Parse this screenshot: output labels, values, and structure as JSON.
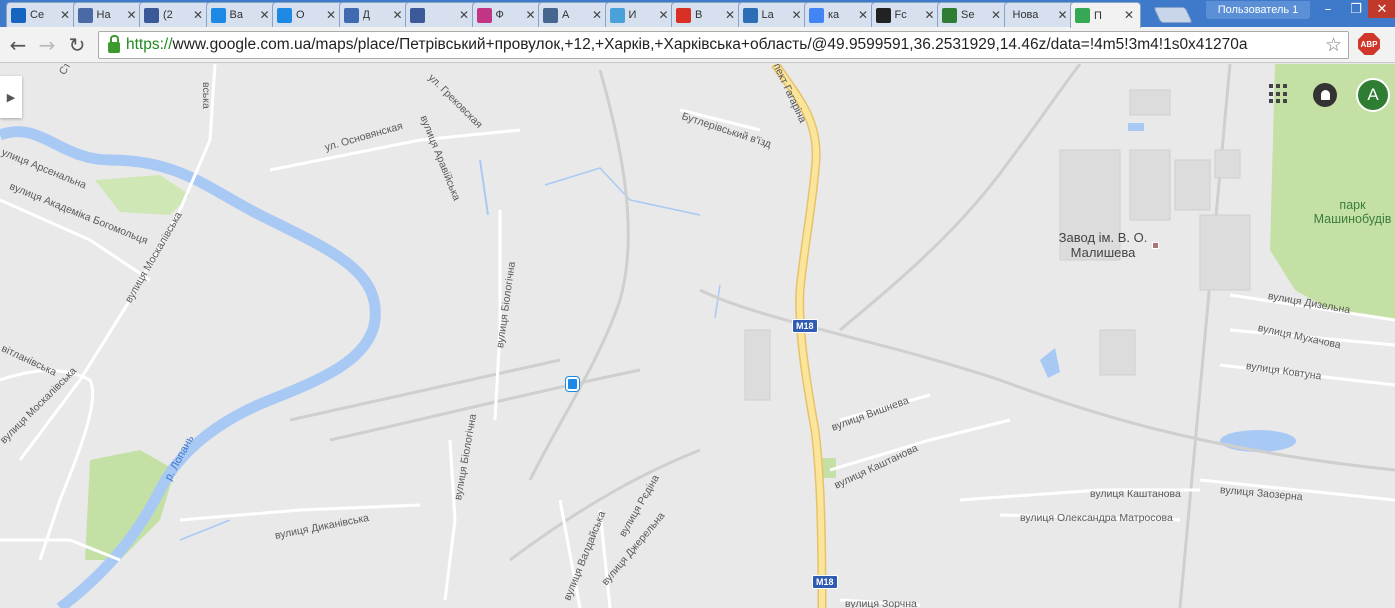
{
  "browser": {
    "tabs": [
      {
        "title": "Ce",
        "icon": "arrow-up-icon",
        "color": "#1565c0"
      },
      {
        "title": "Ha",
        "icon": "bl-icon",
        "color": "#4a6aa5"
      },
      {
        "title": "(2",
        "icon": "facebook-icon",
        "color": "#3b5998"
      },
      {
        "title": "Ba",
        "icon": "ring-icon",
        "color": "#1e88e5"
      },
      {
        "title": "O",
        "icon": "ring-icon",
        "color": "#1e88e5"
      },
      {
        "title": "Д",
        "icon": "chat-icon",
        "color": "#3f6ab0"
      },
      {
        "title": "",
        "icon": "play-icon",
        "color": "#3c5a99"
      },
      {
        "title": "Ф",
        "icon": "instagram-icon",
        "color": "#c13584"
      },
      {
        "title": "A",
        "icon": "vk-icon",
        "color": "#45668e"
      },
      {
        "title": "И",
        "icon": "swirl-icon",
        "color": "#4aa0d8"
      },
      {
        "title": "B",
        "icon": "gmail-icon",
        "color": "#d93025"
      },
      {
        "title": "La",
        "icon": "w-icon",
        "color": "#2d6db5"
      },
      {
        "title": "ка",
        "icon": "google-icon",
        "color": "#4285f4"
      },
      {
        "title": "Fc",
        "icon": "film-icon",
        "color": "#222222"
      },
      {
        "title": "Se",
        "icon": "check-icon",
        "color": "#2e7d32"
      },
      {
        "title": "Нова",
        "icon": "",
        "color": ""
      },
      {
        "title": "П",
        "icon": "maps-icon",
        "color": "#34a853"
      }
    ],
    "close_symbol": "✕",
    "user": "Пользователь 1",
    "url_https": "https://",
    "url_rest": "www.google.com.ua/maps/place/Петрівський+провулок,+12,+Харків,+Харківська+область/@49.9599591,36.2531929,14.46z/data=!4m5!3m4!1s0x41270a",
    "abp": "ABP",
    "back": "←",
    "forward": "→",
    "reload": "↻",
    "star": "☆",
    "minimize": "–",
    "maximize": "❐",
    "window_close": "✕"
  },
  "map": {
    "avatar_letter": "A",
    "streets": [
      "Сте",
      "вська",
      "ул. Грековская",
      "вулиця Аравійська",
      "ул. Основянская",
      "улиця Арсенальна",
      "вулиця Академіка Богомольця",
      "вулиця Москалівська",
      "вітланівська",
      "вулиця Москалівська",
      "вулиця Біологічна",
      "вулиця Біологічна",
      "вулиця Диканівська",
      "вулиця Валдайська",
      "вулиця Рєдіна",
      "вулиця Джерельна",
      "Бутлерівський в'їзд",
      "пект Гагаріна",
      "вулиця Вишнева",
      "вулиця Каштанова",
      "вулиця Каштанова",
      "вулиця Олександра Матросова",
      "вулиця Дизельна",
      "вулиця Мухачова",
      "вулиця Ковтуна",
      "вулиця Заозерна",
      "вулиця Зорчна"
    ],
    "river": "р. Лопань",
    "highway": "M18",
    "landmark": "Завод ім. В. О. Малишева",
    "park": "парк Машинобудів"
  }
}
